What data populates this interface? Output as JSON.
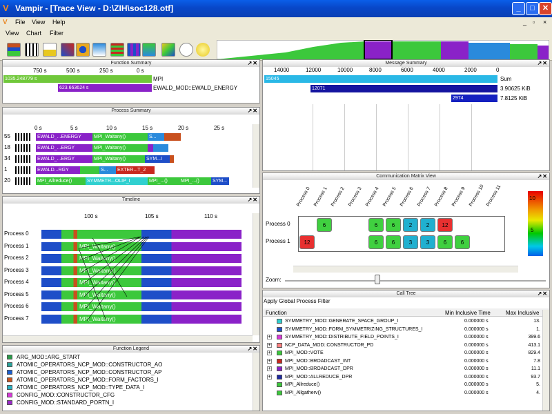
{
  "window": {
    "title": "Vampir - [Trace View - D:\\ZIH\\soc128.otf]",
    "controls": [
      "_",
      "□",
      "✕"
    ],
    "inner_controls": [
      "_",
      "▫",
      "×"
    ]
  },
  "menu1": [
    "File",
    "View",
    "Help"
  ],
  "menu2": [
    "View",
    "Chart",
    "Filter"
  ],
  "panels": {
    "function_summary": "Function Summary",
    "process_summary": "Process Summary",
    "timeline": "Timeline",
    "function_legend": "Function Legend",
    "message_summary": "Message Summary",
    "comm_matrix": "Communication Matrix View",
    "call_tree": "Call Tree"
  },
  "controls_glyph": "↗✕",
  "function_summary": {
    "ticks": [
      "750 s",
      "500 s",
      "250 s",
      "0 s"
    ],
    "rows": [
      {
        "value": "1035.248779 s",
        "name": "MPI",
        "color": "#70c83a",
        "fraction": 1.0
      },
      {
        "value": "623.663624 s",
        "name": "EWALD_MOD::EWALD_ENERGY",
        "color": "#8a22c8",
        "fraction": 0.6
      }
    ]
  },
  "process_summary": {
    "ticks": [
      "0 s",
      "5 s",
      "10 s",
      "15 s",
      "20 s",
      "25 s"
    ],
    "rows": [
      {
        "count": "55",
        "segs": [
          {
            "t": "EWALD_...ENERGY",
            "c": "#8a22c8",
            "w": 82
          },
          {
            "t": "MPI_Waitany()",
            "c": "#3cc83c",
            "w": 80
          },
          {
            "t": "S...",
            "c": "#2a8adc",
            "w": 24
          },
          {
            "t": "",
            "c": "#c8501e",
            "w": 24
          }
        ]
      },
      {
        "count": "18",
        "segs": [
          {
            "t": "EWALD_...ERGY",
            "c": "#8a22c8",
            "w": 82
          },
          {
            "t": "MPI_Waitany()",
            "c": "#3cc83c",
            "w": 80
          },
          {
            "t": "",
            "c": "#8a22c8",
            "w": 8
          },
          {
            "t": "",
            "c": "#2a8adc",
            "w": 22
          }
        ]
      },
      {
        "count": "34",
        "segs": [
          {
            "t": "EWALD_...ERGY",
            "c": "#8a22c8",
            "w": 82
          },
          {
            "t": "MPI_Waitany()",
            "c": "#3cc83c",
            "w": 76
          },
          {
            "t": "SYM...I",
            "c": "#1e4ec8",
            "w": 36
          },
          {
            "t": "",
            "c": "#c8501e",
            "w": 6
          }
        ]
      },
      {
        "count": "1",
        "segs": [
          {
            "t": "EWALD...RGY",
            "c": "#8a22c8",
            "w": 64
          },
          {
            "t": "",
            "c": "#3cc83c",
            "w": 28
          },
          {
            "t": "S...",
            "c": "#2a8adc",
            "w": 24
          },
          {
            "t": "EXTER...T_2",
            "c": "#c8281e",
            "w": 56
          }
        ]
      },
      {
        "count": "20",
        "segs": [
          {
            "t": "MPI_Allreduce()",
            "c": "#3cc83c",
            "w": 72
          },
          {
            "t": "SYMMETR...OLIP_I",
            "c": "#30d0d0",
            "w": 90
          },
          {
            "t": "MPI_...()",
            "c": "#3cc83c",
            "w": 46
          },
          {
            "t": "MPI_...()",
            "c": "#3cc83c",
            "w": 46
          },
          {
            "t": "SYM...",
            "c": "#1e4ec8",
            "w": 26
          }
        ]
      }
    ]
  },
  "timeline": {
    "ticks": [
      "100 s",
      "105 s",
      "110 s"
    ],
    "processes": [
      "Process 0",
      "Process 1",
      "Process 2",
      "Process 3",
      "Process 4",
      "Process 5",
      "Process 6",
      "Process 7"
    ],
    "labels": [
      "",
      "MPI_Waitany()",
      "MPI_Waitany()",
      "MPI_Waitany()",
      "MPI_Waitany()",
      "MPI_Waitany()",
      "MPI_Waitany()",
      "MPI_Waitany()"
    ]
  },
  "legend": [
    {
      "name": "ARG_MOD::ARG_START",
      "color": "#2c9a4a"
    },
    {
      "name": "ATOMIC_OPERATORS_NCP_MOD::CONSTRUCTOR_AO",
      "color": "#2aa39a"
    },
    {
      "name": "ATOMIC_OPERATORS_NCP_MOD::CONSTRUCTOR_AP",
      "color": "#1b5fd0"
    },
    {
      "name": "ATOMIC_OPERATORS_NCP_MOD::FORM_FACTORS_I",
      "color": "#c8541e"
    },
    {
      "name": "ATOMIC_OPERATORS_NCP_MOD::TYPE_DATA_I",
      "color": "#2ab0c0"
    },
    {
      "name": "CONFIG_MOD::CONSTRUCTOR_CFG",
      "color": "#d93ad9"
    },
    {
      "name": "CONFIG_MOD::STANDARD_PORTN_I",
      "color": "#9a2ac8"
    }
  ],
  "message_summary": {
    "ticks": [
      "14000",
      "12000",
      "10000",
      "8000",
      "6000",
      "4000",
      "2000",
      "0"
    ],
    "rows": [
      {
        "value": "15045",
        "unit": "Sum",
        "color": "#2ab8e6",
        "fraction": 1.0
      },
      {
        "value": "12071",
        "unit": "3.90625 KiB",
        "color": "#1414a0",
        "fraction": 0.802
      },
      {
        "value": "2974",
        "unit": "7.8125 KiB",
        "color": "#1420c0",
        "fraction": 0.198
      }
    ]
  },
  "comm_matrix": {
    "columns": [
      "Process 0",
      "Process 1",
      "Process 2",
      "Process 3",
      "Process 4",
      "Process 5",
      "Process 6",
      "Process 7",
      "Process 8",
      "Process 9",
      "Process 10",
      "Process 11"
    ],
    "rows": [
      {
        "label": "Process 0",
        "cells": [
          "",
          "6",
          "",
          "",
          "6",
          "6",
          "2",
          "2",
          "12",
          "",
          "",
          ""
        ]
      },
      {
        "label": "Process 1",
        "cells": [
          "12",
          "",
          "",
          "",
          "6",
          "6",
          "3",
          "3",
          "6",
          "6",
          "",
          ""
        ]
      }
    ],
    "scale": [
      "10",
      "5"
    ],
    "zoom_label": "Zoom:"
  },
  "call_tree": {
    "filter": "Apply Global Process Filter",
    "columns": [
      "Function",
      "Min Inclusive Time",
      "Max Inclusive"
    ],
    "rows": [
      {
        "name": "SYMMETRY_MOD::GENERATE_SPACE_GROUP_I",
        "min": "0.000000 s",
        "max": "13.",
        "color": "#30d0d0",
        "expand": false
      },
      {
        "name": "SYMMETRY_MOD::FORM_SYMMETRIZING_STRUCTURES_I",
        "min": "0.000000 s",
        "max": "1.",
        "color": "#1e4ec8",
        "expand": false
      },
      {
        "name": "SYMMETRY_MOD::DISTRIBUTE_FIELD_POINTS_I",
        "min": "0.000000 s",
        "max": "399.6",
        "color": "#d93ad9",
        "expand": true
      },
      {
        "name": "NCP_DATA_MOD::CONSTRUCTOR_PD",
        "min": "0.000000 s",
        "max": "413.1",
        "color": "#ff8080",
        "expand": true
      },
      {
        "name": "MPI_MOD::VOTE",
        "min": "0.000000 s",
        "max": "829.4",
        "color": "#3cc83c",
        "expand": true
      },
      {
        "name": "MPI_MOD::BROADCAST_INT",
        "min": "0.000000 s",
        "max": "7.8",
        "color": "#c8281e",
        "expand": true
      },
      {
        "name": "MPI_MOD::BROADCAST_DPR",
        "min": "0.000000 s",
        "max": "11.1",
        "color": "#8a22c8",
        "expand": true
      },
      {
        "name": "MPI_MOD::ALLREDUCE_DPR",
        "min": "0.000000 s",
        "max": "93.7",
        "color": "#1e2aa0",
        "expand": true
      },
      {
        "name": "MPI_Allreduce()",
        "min": "0.000000 s",
        "max": "5.",
        "color": "#3cc83c",
        "expand": false
      },
      {
        "name": "MPI_Allgatherv()",
        "min": "0.000000 s",
        "max": "4.",
        "color": "#3cc83c",
        "expand": false
      }
    ]
  }
}
